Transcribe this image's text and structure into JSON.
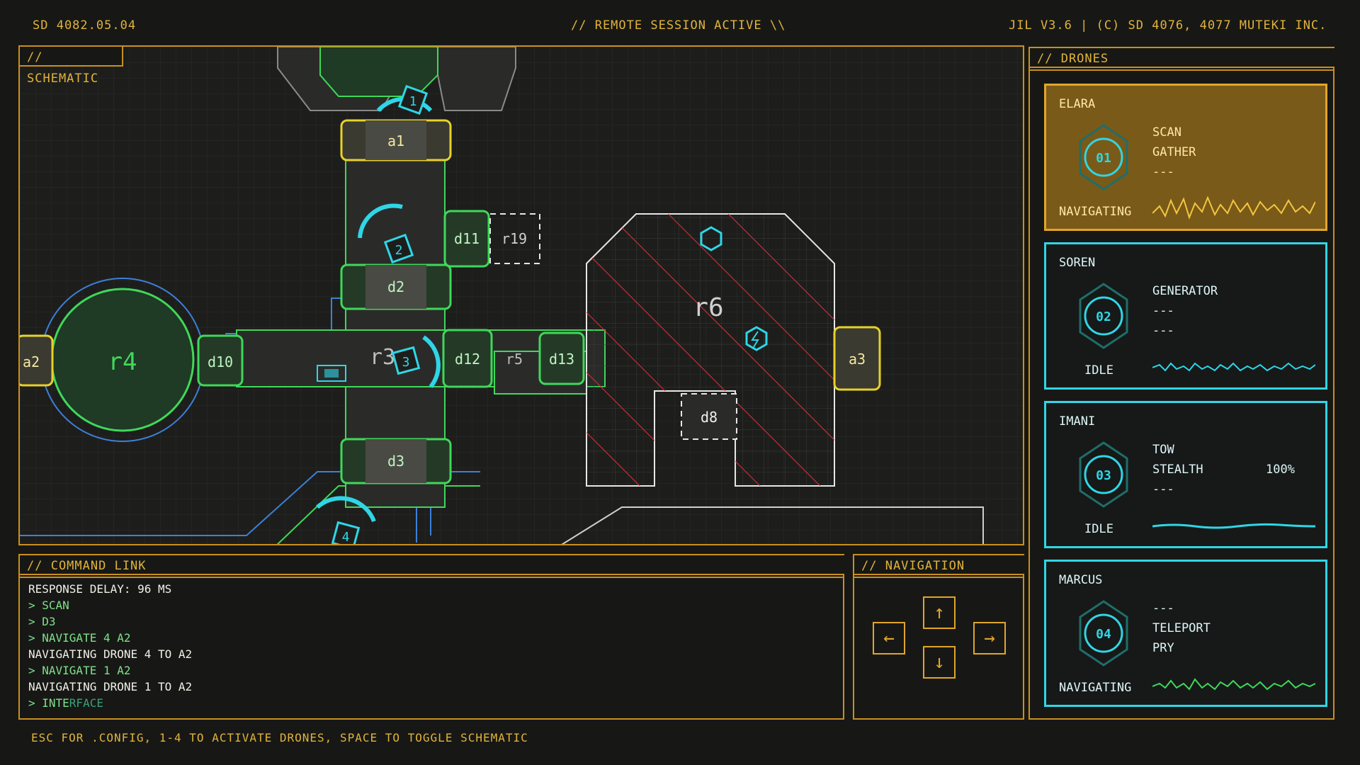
{
  "topbar": {
    "date": "SD 4082.05.04",
    "session": "// REMOTE SESSION ACTIVE \\\\",
    "version": "JIL V3.6  | (C) SD 4076, 4077 MUTEKI INC."
  },
  "schematic": {
    "title": "// SCHEMATIC",
    "rooms": {
      "a1": "a1",
      "a2": "a2",
      "a3": "a3",
      "r4": "r4",
      "r3": "r3",
      "r5": "r5",
      "r6": "r6",
      "r19": "r19",
      "d2": "d2",
      "d3": "d3",
      "d8": "d8",
      "d10": "d10",
      "d11": "d11",
      "d12": "d12",
      "d13": "d13"
    },
    "drone_markers": [
      "1",
      "2",
      "3",
      "4"
    ]
  },
  "drones": {
    "title": "// DRONES",
    "list": [
      {
        "name": "ELARA",
        "num": "01",
        "status": "NAVIGATING",
        "abilities": [
          "SCAN",
          "GATHER",
          "---"
        ],
        "pct": "",
        "selected": true
      },
      {
        "name": "SOREN",
        "num": "02",
        "status": "IDLE",
        "abilities": [
          "GENERATOR",
          "---",
          "---"
        ],
        "pct": "",
        "selected": false
      },
      {
        "name": "IMANI",
        "num": "03",
        "status": "IDLE",
        "abilities": [
          "TOW",
          "STEALTH",
          "---"
        ],
        "pct": "100%",
        "selected": false
      },
      {
        "name": "MARCUS",
        "num": "04",
        "status": "NAVIGATING",
        "abilities": [
          "---",
          "TELEPORT",
          "PRY"
        ],
        "pct": "",
        "selected": false
      }
    ]
  },
  "command": {
    "title": "// COMMAND LINK",
    "lines": [
      "RESPONSE DELAY: 96 MS",
      "> SCAN",
      "> D3",
      "> NAVIGATE 4 A2",
      "NAVIGATING DRONE 4 TO A2",
      "> NAVIGATE 1 A2",
      "NAVIGATING DRONE 1 TO A2",
      "> INTE",
      "RFACE"
    ]
  },
  "navigation": {
    "title": "// NAVIGATION",
    "up": "↑",
    "left": "←",
    "right": "→",
    "down": "↓"
  },
  "footer": {
    "hint": "ESC FOR .CONFIG, 1-4 TO ACTIVATE DRONES, SPACE TO TOGGLE SCHEMATIC"
  },
  "colors": {
    "amber": "#e2a52a",
    "cyan": "#2fd6e6",
    "green": "#3fd85a",
    "red": "#e0394a"
  },
  "icons": [
    "arrow-up-icon",
    "arrow-down-icon",
    "arrow-left-icon",
    "arrow-right-icon",
    "drone-badge-icon",
    "waveform-icon",
    "generator-icon",
    "bolt-icon"
  ]
}
